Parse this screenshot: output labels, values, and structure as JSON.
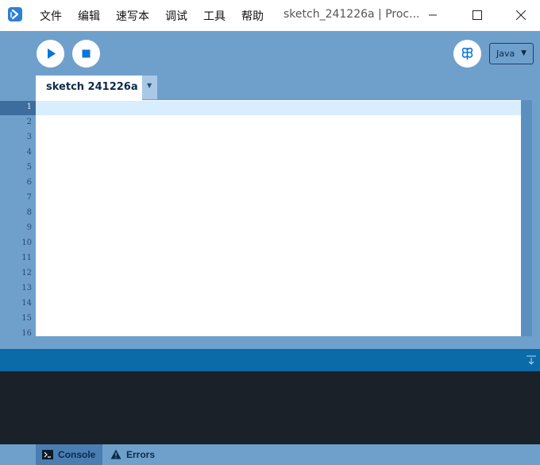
{
  "window": {
    "title": "sketch_241226a | Proc...",
    "icon": "processing-logo-icon",
    "controls": [
      "minimize-icon",
      "maximize-icon",
      "close-icon"
    ]
  },
  "menu": {
    "items": [
      "文件",
      "编辑",
      "速写本",
      "调试",
      "工具",
      "帮助"
    ]
  },
  "toolbar": {
    "run_icon": "play-icon",
    "stop_icon": "stop-icon",
    "debug_icon": "debugger-butterfly-icon",
    "mode": "Java",
    "mode_arrow": "▼"
  },
  "tabs": [
    {
      "label": "sketch 241226a",
      "active": true
    }
  ],
  "tab_menu_arrow": "▼",
  "editor": {
    "line_numbers": [
      "1",
      "2",
      "3",
      "4",
      "5",
      "6",
      "7",
      "8",
      "9",
      "10",
      "11",
      "12",
      "13",
      "14",
      "15",
      "16"
    ],
    "current_line": 1,
    "content": ""
  },
  "footer": {
    "console_label": "Console",
    "errors_label": "Errors"
  },
  "colors": {
    "accent": "#6fa0cc",
    "status_bar": "#0b6aa8",
    "console_bg": "#1b2129",
    "line_highlight": "#d8eeff"
  }
}
